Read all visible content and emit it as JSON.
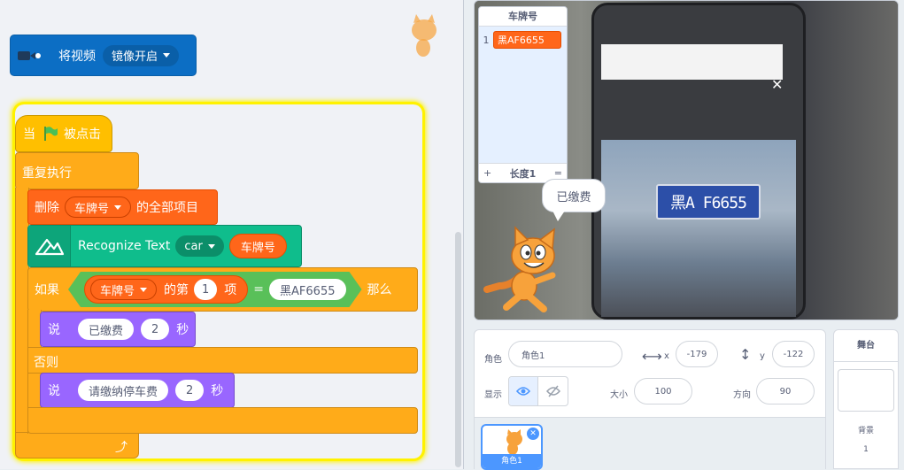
{
  "code": {
    "video_block": {
      "text": "将视频",
      "menu": "镜像开启"
    },
    "hat": {
      "when": "当",
      "clicked": "被点击"
    },
    "forever": "重复执行",
    "delete_all": {
      "text": "删除",
      "list": "车牌号",
      "suffix": "的全部项目"
    },
    "recognize": {
      "text": "Recognize Text",
      "menu": "car",
      "list": "车牌号"
    },
    "if_block": {
      "if": "如果",
      "list": "车牌号",
      "item_of": "的第",
      "index": "1",
      "item": "项",
      "eq": "=",
      "value": "黑AF6655",
      "then": "那么"
    },
    "say1": {
      "say": "说",
      "text": "已缴费",
      "secs": "2",
      "unit": "秒"
    },
    "else": "否则",
    "say2": {
      "say": "说",
      "text": "请缴纳停车费",
      "secs": "2",
      "unit": "秒"
    }
  },
  "stage": {
    "list_title": "车牌号",
    "list_items": [
      {
        "index": "1",
        "value": "黑AF6655"
      }
    ],
    "list_add": "+",
    "list_length": "长度1",
    "list_resize": "=",
    "speech": "已缴费",
    "plate": "黑A F6655"
  },
  "sprite_panel": {
    "sprite_label": "角色",
    "sprite_name": "角色1",
    "x_label": "x",
    "x_value": "-179",
    "y_label": "y",
    "y_value": "-122",
    "show_label": "显示",
    "size_label": "大小",
    "size_value": "100",
    "dir_label": "方向",
    "dir_value": "90",
    "thumb_name": "角色1"
  },
  "stage_panel": {
    "title": "舞台",
    "backdrop_label": "背景",
    "backdrop_count": "1"
  }
}
